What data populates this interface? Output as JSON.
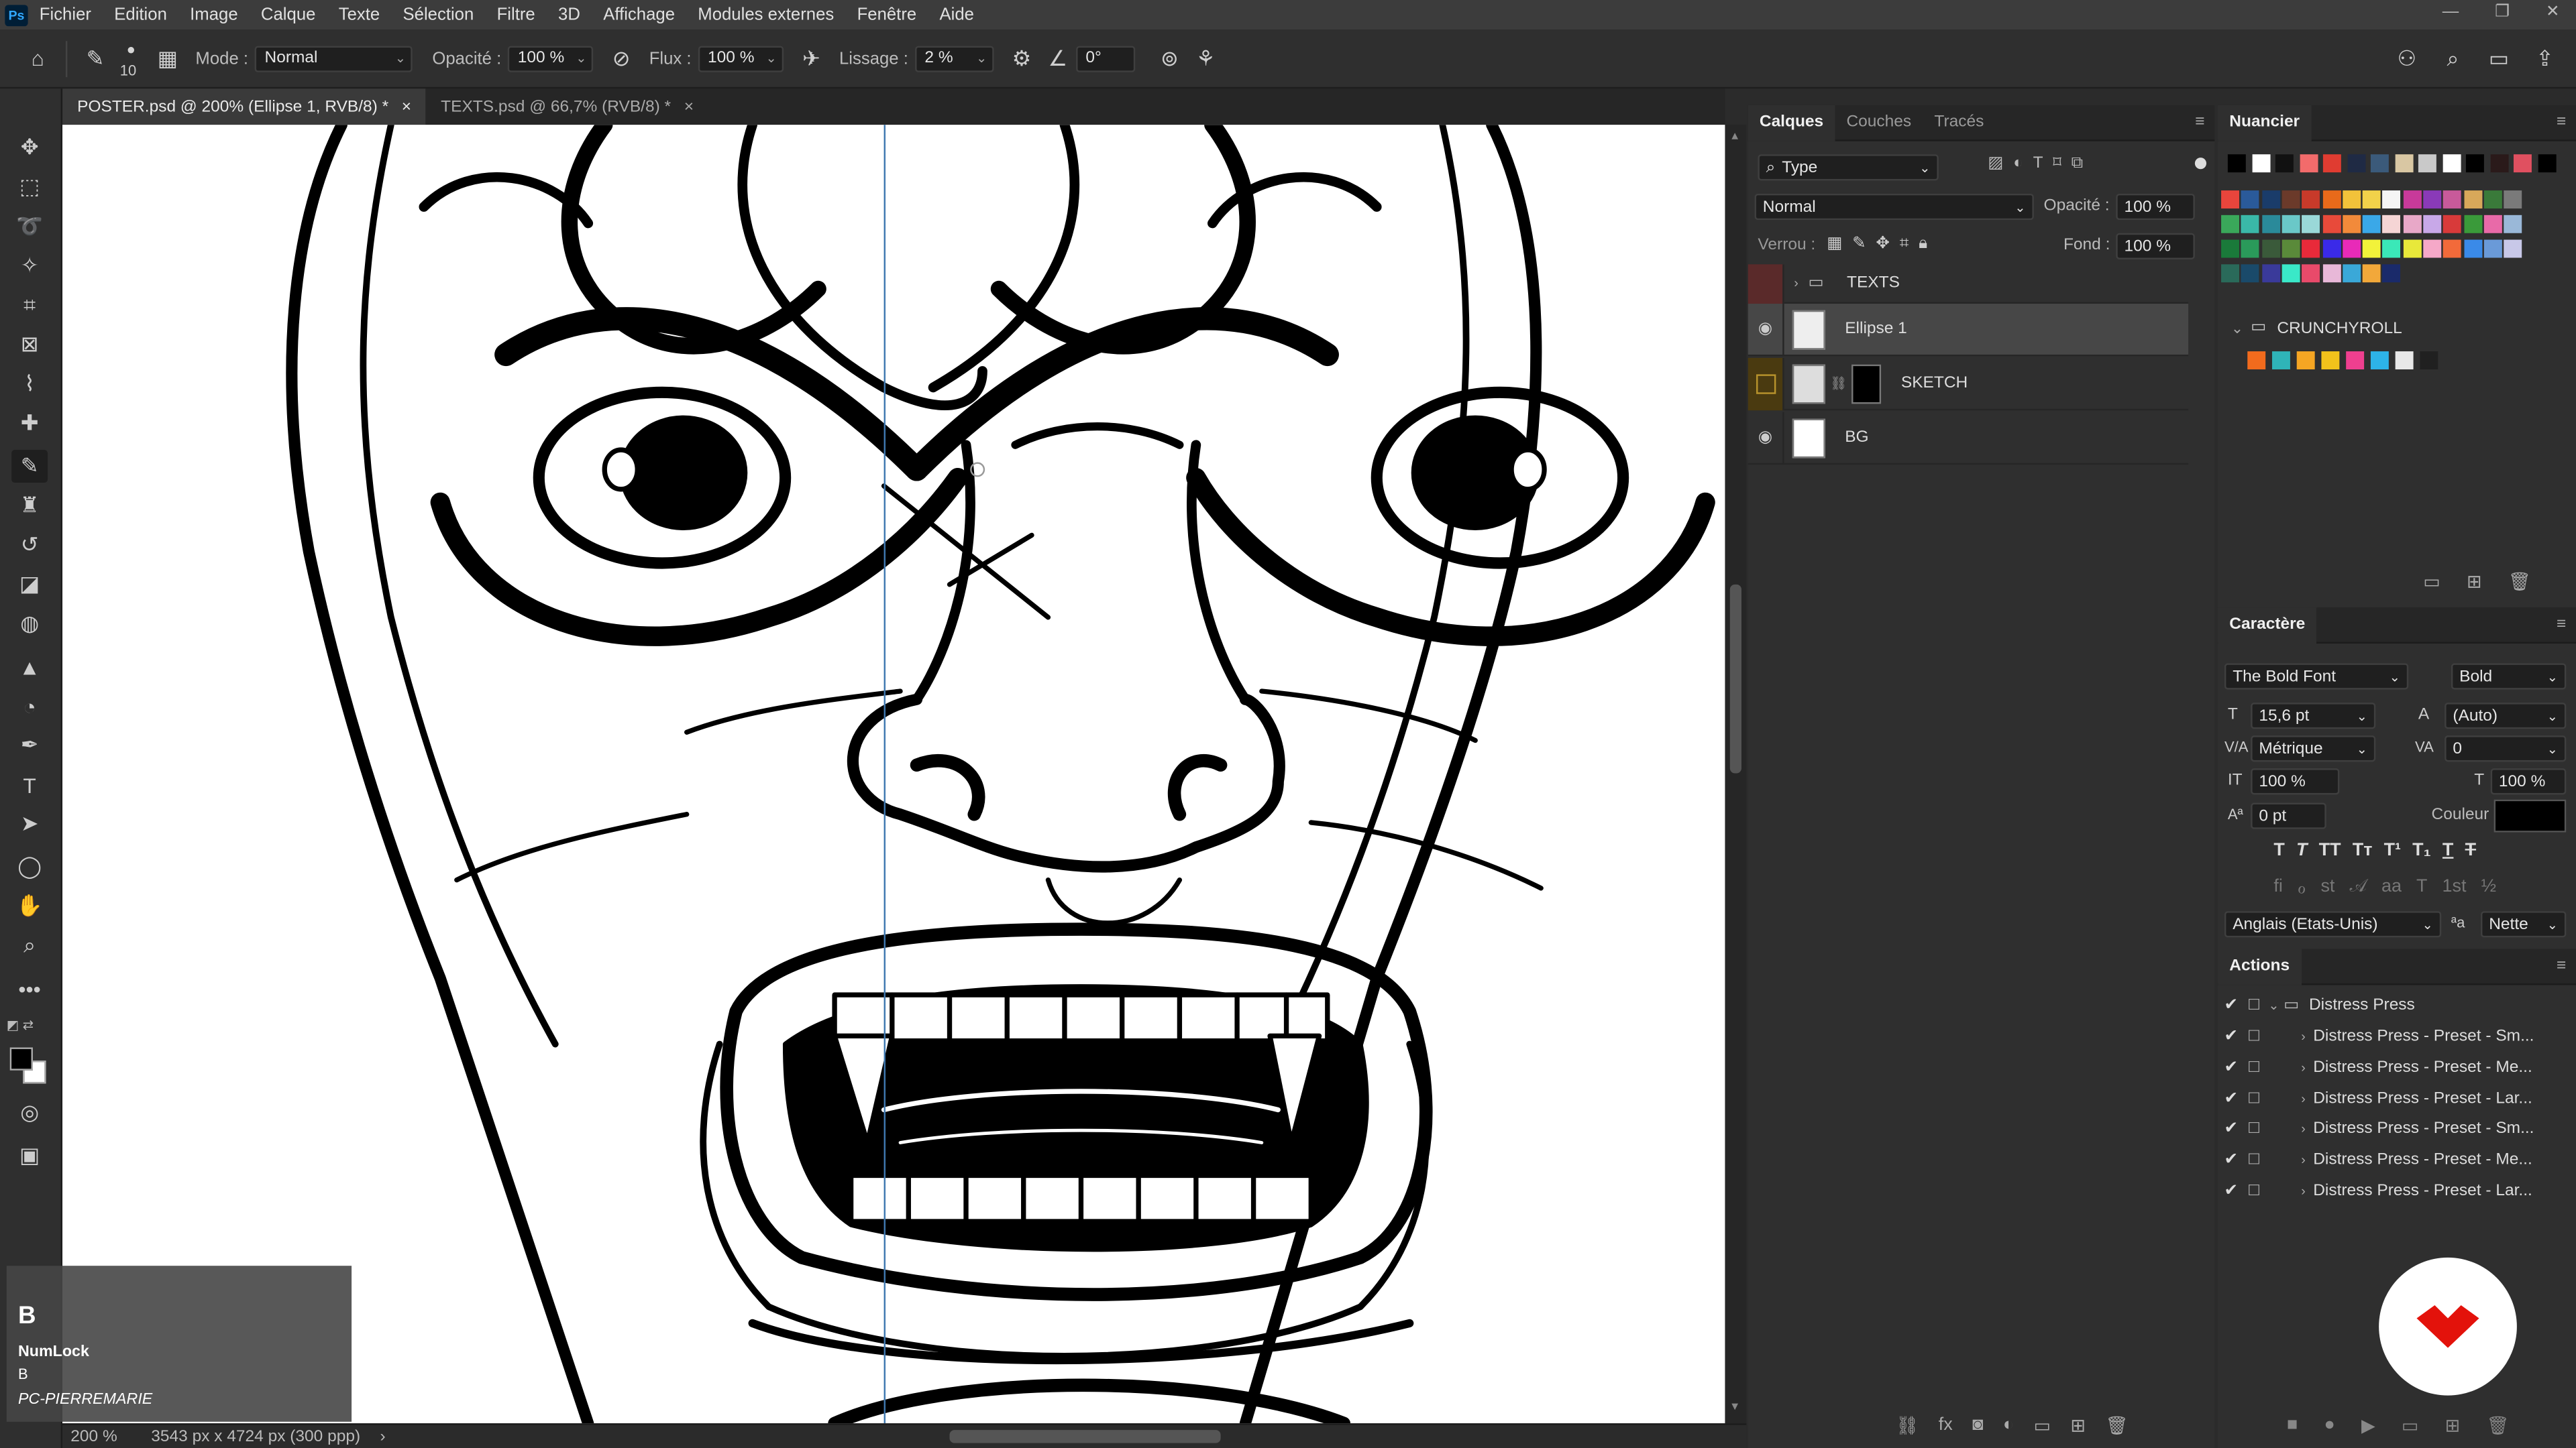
{
  "menu": {
    "logo": "Ps",
    "items": [
      "Fichier",
      "Edition",
      "Image",
      "Calque",
      "Texte",
      "Sélection",
      "Filtre",
      "3D",
      "Affichage",
      "Modules externes",
      "Fenêtre",
      "Aide"
    ]
  },
  "options": {
    "brush_size": "10",
    "mode_label": "Mode :",
    "mode_value": "Normal",
    "opacity_label": "Opacité :",
    "opacity_value": "100 %",
    "flow_label": "Flux :",
    "flow_value": "100 %",
    "smoothing_label": "Lissage :",
    "smoothing_value": "2 %",
    "angle_value": "0°"
  },
  "tabs": [
    {
      "label": "POSTER.psd @ 200% (Ellipse 1, RVB/8) *",
      "close": "×"
    },
    {
      "label": "TEXTS.psd @ 66,7% (RVB/8) *",
      "close": "×"
    }
  ],
  "overlay": {
    "key": "B",
    "title": "NumLock",
    "sub": "B",
    "machine": "PC-PIERREMARIE"
  },
  "status": {
    "zoom": "200 %",
    "doc_size": "3543 px x 4724 px (300 ppp)",
    "arrow": "›"
  },
  "layers_panel": {
    "tabs": [
      "Calques",
      "Couches",
      "Tracés"
    ],
    "filter": "Type",
    "blend": "Normal",
    "opacity_label": "Opacité :",
    "opacity": "100 %",
    "lock_label": "Verrou :",
    "fill_label": "Fond :",
    "fill": "100 %",
    "layers": [
      {
        "name": "TEXTS",
        "type": "group",
        "visible": false
      },
      {
        "name": "Ellipse 1",
        "type": "layer",
        "visible": true,
        "selected": true
      },
      {
        "name": "SKETCH",
        "type": "masked",
        "visible": false
      },
      {
        "name": "BG",
        "type": "layer",
        "visible": true
      }
    ]
  },
  "swatches_panel": {
    "title": "Nuancier",
    "group": "CRUNCHYROLL",
    "top_row": [
      "#000000",
      "#ffffff",
      "#111111",
      "#f26b6b",
      "#e03c31",
      "#1f2a44",
      "#3b5a7a",
      "#d9c7a3",
      "#c9c9c9",
      "#ffffff",
      "#000000",
      "#2a1a1a",
      "#e05060",
      "#000000"
    ],
    "grid": [
      [
        "#e8453c",
        "#2a5a9a",
        "#1a3c6a",
        "#6b3a2a",
        "#c83a2a",
        "#e86a1a",
        "#f2c23a",
        "#f2d24a",
        "#f5f5f5",
        "#c83a9a",
        "#8a3ab8",
        "#c85a9a",
        "#d8a85a",
        "#3a7a3a",
        "#7a7a7a"
      ],
      [
        "#3aa85a",
        "#3ab8a8",
        "#2a8a9a",
        "#6ac8c8",
        "#9ad8d8",
        "#e84a3a",
        "#f28a3a",
        "#3aa8e8",
        "#f5d5d5",
        "#e8a8c8",
        "#c8a8e8",
        "#d83a3a",
        "#3a9a3a",
        "#e86aa8",
        "#9ab8d8"
      ],
      [
        "#1a7a3a",
        "#2a9a5a",
        "#3a5a3a",
        "#5a8a3a",
        "#e82a3a",
        "#3a2ae8",
        "#e82ab8",
        "#f2f23a",
        "#3ae8b8",
        "#e8e83a",
        "#f5a8c8",
        "#f26a3a",
        "#3a8ae8",
        "#6a9ad8",
        "#c8c8e8"
      ],
      [
        "#2a6a5a",
        "#1a4a6a",
        "#3a3a9a",
        "#3ae8c8",
        "#e84a6a",
        "#e8b8d8",
        "#3aa8d8",
        "#f2a83a",
        "#1a2a6a"
      ]
    ],
    "group_colors": [
      "#f26b1d",
      "#2fb4b8",
      "#f5a623",
      "#f2c21b",
      "#ef3f8f",
      "#2db3e8",
      "#e8e8e8",
      "#202020"
    ]
  },
  "character_panel": {
    "title": "Caractère",
    "font": "The Bold Font",
    "style": "Bold",
    "size": "15,6 pt",
    "leading": "(Auto)",
    "kerning": "Métrique",
    "tracking": "0",
    "vscale": "100 %",
    "hscale": "100 %",
    "baseline": "0 pt",
    "color_label": "Couleur :",
    "language": "Anglais (Etats-Unis)",
    "aa": "Nette"
  },
  "actions_panel": {
    "title": "Actions",
    "set": "Distress Press",
    "items": [
      "Distress Press - Preset - Sm...",
      "Distress Press - Preset - Me...",
      "Distress Press - Preset - Lar...",
      "Distress Press - Preset - Sm...",
      "Distress Press - Preset - Me...",
      "Distress Press - Preset - Lar..."
    ]
  },
  "colors": {
    "accent": "#3f78b0",
    "brand_badge": "#e3120b"
  }
}
